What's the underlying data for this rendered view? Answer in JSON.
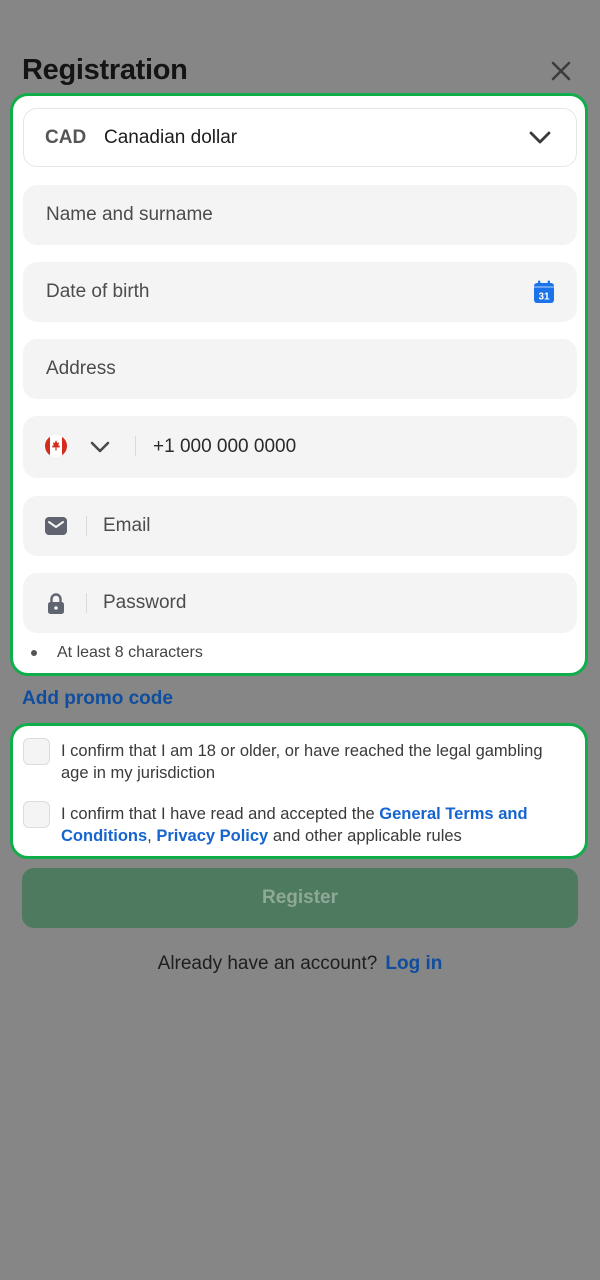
{
  "header": {
    "title": "Registration"
  },
  "form": {
    "currency": {
      "code": "CAD",
      "name": "Canadian dollar"
    },
    "name_placeholder": "Name and surname",
    "dob_placeholder": "Date of birth",
    "calendar_day": "31",
    "address_placeholder": "Address",
    "phone": {
      "value": "+1 000 000 0000"
    },
    "email_placeholder": "Email",
    "password_placeholder": "Password",
    "password_hint": "At least 8 characters"
  },
  "promo": {
    "label": "Add promo code"
  },
  "consent": {
    "age_text": "I confirm that I am 18 or older, or have reached the legal gambling age in my jurisdiction",
    "terms_prefix": "I confirm that I have read and accepted the ",
    "terms_link": "General Terms and Conditions",
    "terms_sep": ", ",
    "privacy_link": "Privacy Policy",
    "terms_suffix": " and other applicable rules"
  },
  "register": {
    "label": "Register"
  },
  "login": {
    "prompt": "Already have an account?",
    "link": "Log in"
  },
  "colors": {
    "accent_green": "#0fae4a",
    "link_blue": "#1665cf",
    "overlay": "#868686",
    "register_disabled": "#4e7b60"
  }
}
